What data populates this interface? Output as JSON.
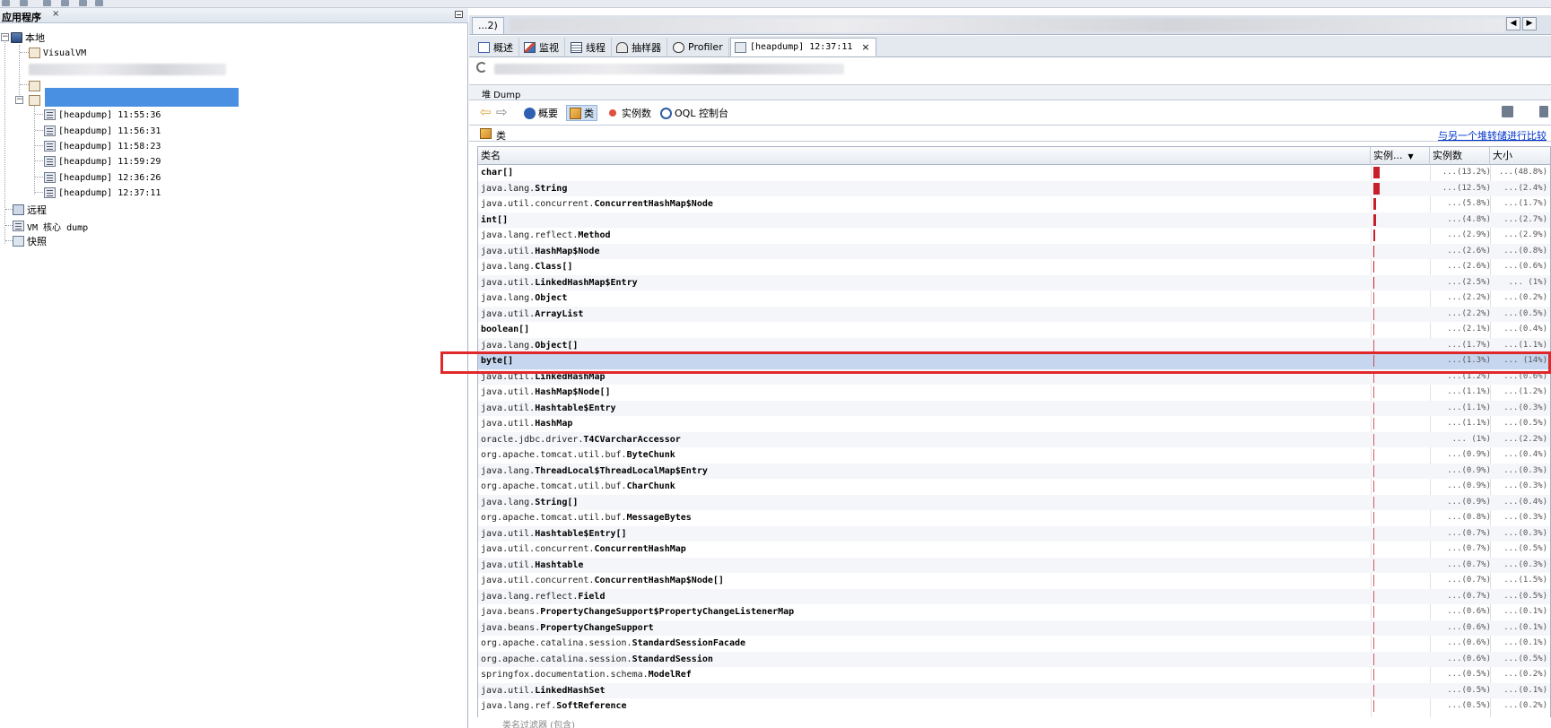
{
  "left_panel": {
    "title": "应用程序",
    "close": "×",
    "tree": {
      "local": "本地",
      "visualvm": "VisualVM",
      "heapdumps": [
        "[heapdump] 11:55:36",
        "[heapdump] 11:56:31",
        "[heapdump] 11:58:23",
        "[heapdump] 11:59:29",
        "[heapdump] 12:36:26",
        "[heapdump] 12:37:11"
      ],
      "remote": "远程",
      "vm_core_dump": "VM 核心 dump",
      "snapshots": "快照"
    }
  },
  "doc_tabs": {
    "first": "...2)"
  },
  "view_tabs": {
    "overview": "概述",
    "monitor": "监视",
    "threads": "线程",
    "sampler": "抽样器",
    "profiler": "Profiler",
    "heapdump": "[heapdump] 12:37:11",
    "close": "×"
  },
  "heap": {
    "header": "堆 Dump",
    "toolbar": {
      "overview": "概要",
      "classes": "类",
      "instances": "实例数",
      "oql": "OQL 控制台"
    },
    "classes_label": "类",
    "compare_link": "与另一个堆转储进行比较",
    "filter_placeholder": "类名过滤器 (包含)"
  },
  "table": {
    "columns": {
      "name": "类名",
      "instances_bar": "实例...",
      "instances": "实例数",
      "size": "大小"
    },
    "rows": [
      {
        "pkg": "",
        "cls": "char[]",
        "inst": "...(13.2%)",
        "size": "...(48.8%)",
        "pct": 13.2
      },
      {
        "pkg": "java.lang.",
        "cls": "String",
        "inst": "...(12.5%)",
        "size": "...(2.4%)",
        "pct": 12.5
      },
      {
        "pkg": "java.util.concurrent.",
        "cls": "ConcurrentHashMap$Node",
        "inst": "...(5.8%)",
        "size": "...(1.7%)",
        "pct": 5.8
      },
      {
        "pkg": "",
        "cls": "int[]",
        "inst": "...(4.8%)",
        "size": "...(2.7%)",
        "pct": 4.8
      },
      {
        "pkg": "java.lang.reflect.",
        "cls": "Method",
        "inst": "...(2.9%)",
        "size": "...(2.9%)",
        "pct": 2.9
      },
      {
        "pkg": "java.util.",
        "cls": "HashMap$Node",
        "inst": "...(2.6%)",
        "size": "...(0.8%)",
        "pct": 2.6
      },
      {
        "pkg": "java.lang.",
        "cls": "Class[]",
        "inst": "...(2.6%)",
        "size": "...(0.6%)",
        "pct": 2.6
      },
      {
        "pkg": "java.util.",
        "cls": "LinkedHashMap$Entry",
        "inst": "...(2.5%)",
        "size": "... (1%)",
        "pct": 2.5
      },
      {
        "pkg": "java.lang.",
        "cls": "Object",
        "inst": "...(2.2%)",
        "size": "...(0.2%)",
        "pct": 2.2
      },
      {
        "pkg": "java.util.",
        "cls": "ArrayList",
        "inst": "...(2.2%)",
        "size": "...(0.5%)",
        "pct": 2.2
      },
      {
        "pkg": "",
        "cls": "boolean[]",
        "inst": "...(2.1%)",
        "size": "...(0.4%)",
        "pct": 2.1
      },
      {
        "pkg": "java.lang.",
        "cls": "Object[]",
        "inst": "...(1.7%)",
        "size": "...(1.1%)",
        "pct": 1.7
      },
      {
        "pkg": "",
        "cls": "byte[]",
        "inst": "...(1.3%)",
        "size": "... (14%)",
        "pct": 1.3,
        "selected": true
      },
      {
        "pkg": "java.util.",
        "cls": "LinkedHashMap",
        "inst": "...(1.2%)",
        "size": "...(0.6%)",
        "pct": 1.2
      },
      {
        "pkg": "java.util.",
        "cls": "HashMap$Node[]",
        "inst": "...(1.1%)",
        "size": "...(1.2%)",
        "pct": 1.1
      },
      {
        "pkg": "java.util.",
        "cls": "Hashtable$Entry",
        "inst": "...(1.1%)",
        "size": "...(0.3%)",
        "pct": 1.1
      },
      {
        "pkg": "java.util.",
        "cls": "HashMap",
        "inst": "...(1.1%)",
        "size": "...(0.5%)",
        "pct": 1.1
      },
      {
        "pkg": "oracle.jdbc.driver.",
        "cls": "T4CVarcharAccessor",
        "inst": "... (1%)",
        "size": "...(2.2%)",
        "pct": 1.0
      },
      {
        "pkg": "org.apache.tomcat.util.buf.",
        "cls": "ByteChunk",
        "inst": "...(0.9%)",
        "size": "...(0.4%)",
        "pct": 0.9
      },
      {
        "pkg": "java.lang.",
        "cls": "ThreadLocal$ThreadLocalMap$Entry",
        "inst": "...(0.9%)",
        "size": "...(0.3%)",
        "pct": 0.9
      },
      {
        "pkg": "org.apache.tomcat.util.buf.",
        "cls": "CharChunk",
        "inst": "...(0.9%)",
        "size": "...(0.3%)",
        "pct": 0.9
      },
      {
        "pkg": "java.lang.",
        "cls": "String[]",
        "inst": "...(0.9%)",
        "size": "...(0.4%)",
        "pct": 0.9
      },
      {
        "pkg": "org.apache.tomcat.util.buf.",
        "cls": "MessageBytes",
        "inst": "...(0.8%)",
        "size": "...(0.3%)",
        "pct": 0.8
      },
      {
        "pkg": "java.util.",
        "cls": "Hashtable$Entry[]",
        "inst": "...(0.7%)",
        "size": "...(0.3%)",
        "pct": 0.7
      },
      {
        "pkg": "java.util.concurrent.",
        "cls": "ConcurrentHashMap",
        "inst": "...(0.7%)",
        "size": "...(0.5%)",
        "pct": 0.7
      },
      {
        "pkg": "java.util.",
        "cls": "Hashtable",
        "inst": "...(0.7%)",
        "size": "...(0.3%)",
        "pct": 0.7
      },
      {
        "pkg": "java.util.concurrent.",
        "cls": "ConcurrentHashMap$Node[]",
        "inst": "...(0.7%)",
        "size": "...(1.5%)",
        "pct": 0.7
      },
      {
        "pkg": "java.lang.reflect.",
        "cls": "Field",
        "inst": "...(0.7%)",
        "size": "...(0.5%)",
        "pct": 0.7
      },
      {
        "pkg": "java.beans.",
        "cls": "PropertyChangeSupport$PropertyChangeListenerMap",
        "inst": "...(0.6%)",
        "size": "...(0.1%)",
        "pct": 0.6
      },
      {
        "pkg": "java.beans.",
        "cls": "PropertyChangeSupport",
        "inst": "...(0.6%)",
        "size": "...(0.1%)",
        "pct": 0.6
      },
      {
        "pkg": "org.apache.catalina.session.",
        "cls": "StandardSessionFacade",
        "inst": "...(0.6%)",
        "size": "...(0.1%)",
        "pct": 0.6
      },
      {
        "pkg": "org.apache.catalina.session.",
        "cls": "StandardSession",
        "inst": "...(0.6%)",
        "size": "...(0.5%)",
        "pct": 0.6
      },
      {
        "pkg": "springfox.documentation.schema.",
        "cls": "ModelRef",
        "inst": "...(0.5%)",
        "size": "...(0.2%)",
        "pct": 0.5
      },
      {
        "pkg": "java.util.",
        "cls": "LinkedHashSet",
        "inst": "...(0.5%)",
        "size": "...(0.1%)",
        "pct": 0.5
      },
      {
        "pkg": "java.lang.ref.",
        "cls": "SoftReference",
        "inst": "...(0.5%)",
        "size": "...(0.2%)",
        "pct": 0.5
      }
    ]
  },
  "colors": {
    "bar": "#c8202a",
    "selection": "#c5d6ee",
    "highlight_box": "#e0282a",
    "link": "#0033cc"
  }
}
